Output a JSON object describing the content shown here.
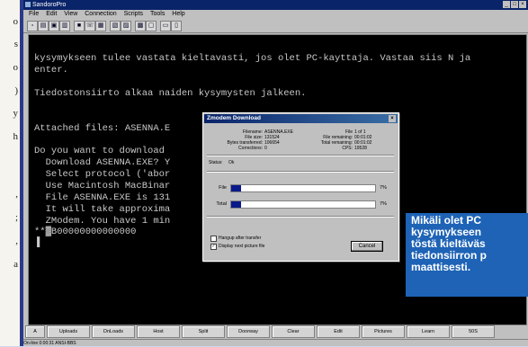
{
  "page_margin": {
    "text_fragments": [
      "o",
      "s",
      "o",
      "",
      ")",
      "",
      "y",
      "",
      "h",
      "",
      "",
      "",
      "",
      "",
      ",",
      "",
      ";",
      "",
      ",",
      "a",
      "",
      ""
    ]
  },
  "window": {
    "title": "SandoroPro",
    "menu": [
      "File",
      "Edit",
      "View",
      "Connection",
      "Scripts",
      "Tools",
      "Help"
    ]
  },
  "terminal": {
    "lines": [
      "kysymykseen tulee vastata kieltavasti, jos olet PC-kayttaja. Vastaa siis N ja",
      "enter.",
      "",
      "Tiedostonsiirto alkaa naiden kysymysten jalkeen.",
      "",
      "",
      "Attached files: ASENNA.E",
      "",
      "Do you want to download",
      "  Download ASENNA.EXE? Y",
      "  Select protocol ('abor",
      "  Use Macintosh MacBinar",
      "  File ASENNA.EXE is 131",
      "  It will take approxima",
      "  ZModem. You have 1 min",
      "**▓B00000000000000",
      "▐"
    ]
  },
  "dialog": {
    "title": "Zmodem Download",
    "info_left": [
      {
        "label": "Filename:",
        "value": "ASENNA.EXE"
      },
      {
        "label": "File size:",
        "value": "131524"
      },
      {
        "label": "Bytes transferred:",
        "value": "106654"
      },
      {
        "label": "Corrections:",
        "value": "0"
      }
    ],
    "info_right": [
      {
        "label": "File",
        "value": "1 of 1"
      },
      {
        "label": "File remaining:",
        "value": "00:01:02"
      },
      {
        "label": "Total remaining:",
        "value": "00:01:02"
      },
      {
        "label": "CPS:",
        "value": "19528"
      }
    ],
    "status_label": "Status:",
    "status_value": "Ok",
    "file_label": "File",
    "file_progress": 0.07,
    "file_pct": "7%",
    "total_label": "Total",
    "total_progress": 0.07,
    "total_pct": "7%",
    "hangup_label": "Hangup after transfer",
    "display_label": "Display next picture file",
    "cancel_label": "Cancel"
  },
  "buttons": [
    "A",
    "Uploads",
    "DnLoads",
    "Host",
    "Split",
    "Doorway",
    "Clear",
    "Edit",
    "Pictures",
    "Learn",
    "50S"
  ],
  "statusbar_text": "On-line 0:00:31   ANSI-BBS",
  "caption": {
    "lines": [
      "Mikäli olet PC",
      "kysymykseen",
      "töstä kieltäväs",
      "tiedonsiirron p",
      "maattisesti."
    ]
  },
  "colors": {
    "terminal_bg": "#000000",
    "terminal_fg": "#c8c8c8",
    "title_bg": "#0a246a",
    "caption_bg": "#1e63b6"
  }
}
